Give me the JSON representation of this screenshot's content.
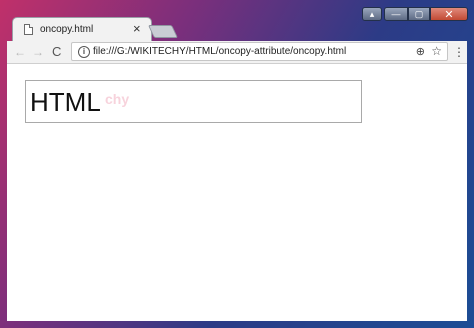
{
  "tab": {
    "title": "oncopy.html",
    "close_glyph": "×",
    "page_icon": "page-icon"
  },
  "window_controls": {
    "user_glyph": "▴",
    "minimize_glyph": "—",
    "maximize_glyph": "▢",
    "close_glyph": "✕"
  },
  "toolbar": {
    "back_glyph": "←",
    "forward_glyph": "→",
    "reload_glyph": "C",
    "info_glyph": "i",
    "url": "file:///G:/WIKITECHY/HTML/oncopy-attribute/oncopy.html",
    "zoom_glyph": "⊕",
    "star_glyph": "☆",
    "menu_glyph": "⋮"
  },
  "page": {
    "input_value": "HTML",
    "watermark": "chy"
  },
  "colors": {
    "desktop_accent": "#c0306a",
    "tab_background": "#f2f2f2",
    "window_close": "#c24a34"
  }
}
